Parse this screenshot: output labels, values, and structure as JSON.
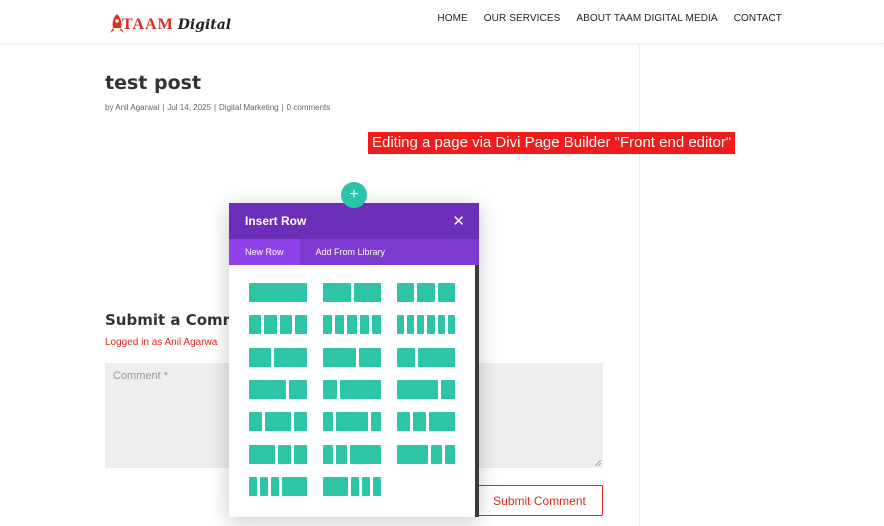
{
  "header": {
    "logo_brand": "TAAM",
    "logo_sub": "Digital",
    "nav": [
      "HOME",
      "OUR SERVICES",
      "ABOUT TAAM DIGITAL MEDIA",
      "CONTACT"
    ]
  },
  "post": {
    "title": "test post",
    "meta": {
      "prefix": "by",
      "author": "Anil Agarwal",
      "date": "Jul 14, 2025",
      "category": "Digital Marketing",
      "comments": "0 comments"
    }
  },
  "annotation": "Editing a page via Divi Page Builder \"Front end editor\"",
  "comments": {
    "title": "Submit a Comme",
    "logged_in": "Logged in as Anil Agarwa",
    "placeholder": "Comment *",
    "submit_label": "Submit Comment"
  },
  "add_button_symbol": "+",
  "modal": {
    "title": "Insert Row",
    "close_symbol": "✕",
    "tabs": [
      {
        "label": "New Row",
        "active": true
      },
      {
        "label": "Add From Library",
        "active": false
      }
    ],
    "layouts": [
      "1",
      "1/2,1/2",
      "1/3,1/3,1/3",
      "1/4,1/4,1/4,1/4",
      "1/5,1/5,1/5,1/5,1/5",
      "1/6,1/6,1/6,1/6,1/6,1/6",
      "2/5,3/5",
      "3/5,2/5",
      "1/3,2/3",
      "2/3,1/3",
      "1/4,3/4",
      "3/4,1/4",
      "1/4,1/2,1/4",
      "1/5,3/5,1/5",
      "1/4,1/4,1/2",
      "1/2,1/4,1/4",
      "1/5,1/5,3/5",
      "3/5,1/5,1/5",
      "1/6,1/6,1/6,1/2",
      "1/2,1/6,1/6,1/6"
    ]
  },
  "colors": {
    "brand_red": "#e02b20",
    "divi_purple": "#6c2eb9",
    "divi_green": "#2ec4a6",
    "banner_red": "#f21b1b"
  }
}
